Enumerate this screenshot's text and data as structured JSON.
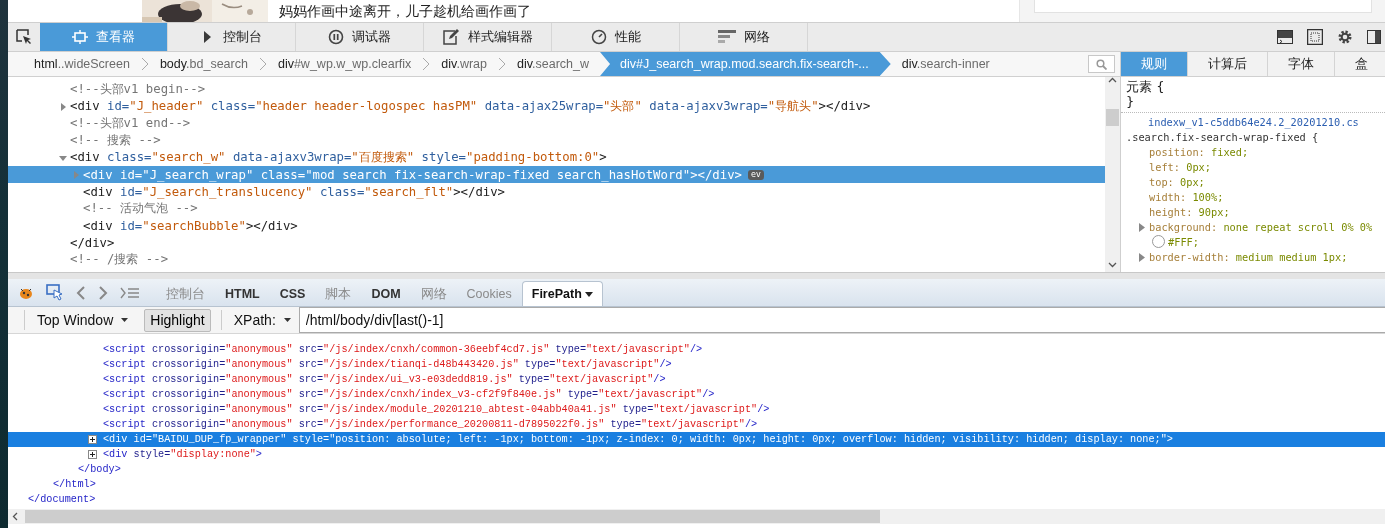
{
  "webpage": {
    "headline": "妈妈作画中途离开，儿子趁机给画作画了"
  },
  "devtools": {
    "tabs": [
      {
        "label": "查看器",
        "selected": true
      },
      {
        "label": "控制台",
        "selected": false
      },
      {
        "label": "调试器",
        "selected": false
      },
      {
        "label": "样式编辑器",
        "selected": false
      },
      {
        "label": "性能",
        "selected": false
      },
      {
        "label": "网络",
        "selected": false
      }
    ]
  },
  "breadcrumbs": [
    {
      "tag": "html",
      "detail": "..wideScreen",
      "selected": false
    },
    {
      "tag": "body",
      "detail": ".bd_search",
      "selected": false
    },
    {
      "tag": "div",
      "detail": "#w_wp.w_wp.clearfix",
      "selected": false
    },
    {
      "tag": "div",
      "detail": ".wrap",
      "selected": false
    },
    {
      "tag": "div",
      "detail": ".search_w",
      "selected": false
    },
    {
      "tag": "div",
      "detail": "#J_search_wrap.mod.search.fix-search-...",
      "selected": true
    },
    {
      "tag": "div",
      "detail": ".search-inner",
      "selected": false
    }
  ],
  "markup_view": {
    "nodes": [
      {
        "selected": false,
        "tokens": [
          {
            "kind": "comment",
            "text": "<!--头部v1 begin-->"
          }
        ]
      },
      {
        "selected": false,
        "expanded": false,
        "tokens": [
          {
            "kind": "tag",
            "text": "<div"
          },
          {
            "kind": "attr",
            "text": " id="
          },
          {
            "kind": "value",
            "text": "\"J_header\""
          },
          {
            "kind": "attr",
            "text": " class="
          },
          {
            "kind": "value",
            "text": "\"header header-logospec hasPM\""
          },
          {
            "kind": "attr",
            "text": " data-ajax25wrap="
          },
          {
            "kind": "value",
            "text": "\"头部\""
          },
          {
            "kind": "attr",
            "text": " data-ajaxv3wrap="
          },
          {
            "kind": "value",
            "text": "\"导航头\""
          },
          {
            "kind": "tag",
            "text": "></div>"
          }
        ]
      },
      {
        "selected": false,
        "tokens": [
          {
            "kind": "comment",
            "text": "<!--头部v1 end-->"
          }
        ]
      },
      {
        "selected": false,
        "tokens": [
          {
            "kind": "comment",
            "text": "<!-- 搜索 -->"
          }
        ]
      },
      {
        "selected": false,
        "expanded": true,
        "tokens": [
          {
            "kind": "tag",
            "text": "<div"
          },
          {
            "kind": "attr",
            "text": " class="
          },
          {
            "kind": "value",
            "text": "\"search_w\""
          },
          {
            "kind": "attr",
            "text": " data-ajaxv3wrap="
          },
          {
            "kind": "value",
            "text": "\"百度搜索\""
          },
          {
            "kind": "attr",
            "text": " style="
          },
          {
            "kind": "value",
            "text": "\"padding-bottom:0\""
          },
          {
            "kind": "tag",
            "text": ">"
          }
        ],
        "children": [
          {
            "selected": true,
            "expanded": false,
            "badge": "ev",
            "tokens": [
              {
                "kind": "tag",
                "text": "<div"
              },
              {
                "kind": "attr",
                "text": " id="
              },
              {
                "kind": "value",
                "text": "\"J_search_wrap\""
              },
              {
                "kind": "attr",
                "text": " class="
              },
              {
                "kind": "value",
                "text": "\"mod search fix-search-wrap-fixed search_hasHotWord\""
              },
              {
                "kind": "tag",
                "text": "></div>"
              }
            ]
          },
          {
            "selected": false,
            "tokens": [
              {
                "kind": "tag",
                "text": "<div"
              },
              {
                "kind": "attr",
                "text": " id="
              },
              {
                "kind": "value",
                "text": "\"J_search_translucency\""
              },
              {
                "kind": "attr",
                "text": " class="
              },
              {
                "kind": "value",
                "text": "\"search_flt\""
              },
              {
                "kind": "tag",
                "text": "></div>"
              }
            ]
          },
          {
            "selected": false,
            "tokens": [
              {
                "kind": "comment",
                "text": "<!-- 活动气泡 -->"
              }
            ]
          },
          {
            "selected": false,
            "tokens": [
              {
                "kind": "tag",
                "text": "<div"
              },
              {
                "kind": "attr",
                "text": " id="
              },
              {
                "kind": "value",
                "text": "\"searchBubble\""
              },
              {
                "kind": "tag",
                "text": "></div>"
              }
            ]
          }
        ],
        "closing": [
          {
            "kind": "tag",
            "text": "</div>"
          }
        ]
      },
      {
        "selected": false,
        "tokens": [
          {
            "kind": "comment",
            "text": "<!-- /搜索 -->"
          }
        ]
      }
    ]
  },
  "rules_panel": {
    "tabs": [
      {
        "label": "规则",
        "selected": true
      },
      {
        "label": "计算后",
        "selected": false
      },
      {
        "label": "字体",
        "selected": false
      },
      {
        "label": "盒",
        "selected": false
      }
    ],
    "element_rule": {
      "open": "元素 {",
      "close": "}"
    },
    "rule": {
      "source": "indexw_v1-c5ddb64e24.2_20201210.cs",
      "selector": ".search.fix-search-wrap-fixed {",
      "declarations": [
        {
          "name": "position:",
          "value": "fixed;",
          "expandable": false
        },
        {
          "name": "left:",
          "value": "0px;",
          "expandable": false
        },
        {
          "name": "top:",
          "value": "0px;",
          "expandable": false
        },
        {
          "name": "width:",
          "value": "100%;",
          "expandable": false
        },
        {
          "name": "height:",
          "value": "90px;",
          "expandable": false
        },
        {
          "name": "background:",
          "value": "none repeat scroll 0% 0%",
          "color_value": "#FFF;",
          "expandable": true
        },
        {
          "name": "border-width:",
          "value": "medium medium 1px;",
          "expandable": true
        }
      ]
    }
  },
  "firebug": {
    "tabs": [
      {
        "label": "控制台",
        "disabled": true,
        "selected": false,
        "menu": false
      },
      {
        "label": "HTML",
        "disabled": false,
        "selected": false,
        "menu": false
      },
      {
        "label": "CSS",
        "disabled": false,
        "selected": false,
        "menu": false
      },
      {
        "label": "脚本",
        "disabled": true,
        "selected": false,
        "menu": false
      },
      {
        "label": "DOM",
        "disabled": false,
        "selected": false,
        "menu": false
      },
      {
        "label": "网络",
        "disabled": true,
        "selected": false,
        "menu": false
      },
      {
        "label": "Cookies",
        "disabled": true,
        "selected": false,
        "menu": false
      },
      {
        "label": "FirePath",
        "disabled": false,
        "selected": true,
        "menu": true
      }
    ]
  },
  "firepath": {
    "frame_menu": "Top Window",
    "highlight": {
      "label": "Highlight",
      "pressed": true
    },
    "type_menu": "XPath:",
    "expression": "/html/body/div[last()-1]"
  },
  "firepath_tree": {
    "nodes": [
      {
        "selected": false,
        "closing": [
          {
            "kind": "tag",
            "text": "</document>"
          }
        ],
        "children": [
          {
            "selected": false,
            "closing": [
              {
                "kind": "tag",
                "text": "</html>"
              }
            ],
            "children": [
              {
                "selected": false,
                "closing": [
                  {
                    "kind": "tag",
                    "text": "</body>"
                  }
                ],
                "children": [
                  {
                    "selected": false,
                    "tokens": [
                      {
                        "kind": "tag",
                        "text": "<script"
                      },
                      {
                        "kind": "attr",
                        "text": " crossorigin="
                      },
                      {
                        "kind": "value",
                        "text": "\"anonymous\""
                      },
                      {
                        "kind": "attr",
                        "text": " src="
                      },
                      {
                        "kind": "value",
                        "text": "\"/js/index/cnxh/common-36eebf4cd7.js\""
                      },
                      {
                        "kind": "attr",
                        "text": " type="
                      },
                      {
                        "kind": "value",
                        "text": "\"text/javascript\""
                      },
                      {
                        "kind": "tag",
                        "text": "/>"
                      }
                    ]
                  },
                  {
                    "selected": false,
                    "tokens": [
                      {
                        "kind": "tag",
                        "text": "<script"
                      },
                      {
                        "kind": "attr",
                        "text": " crossorigin="
                      },
                      {
                        "kind": "value",
                        "text": "\"anonymous\""
                      },
                      {
                        "kind": "attr",
                        "text": " src="
                      },
                      {
                        "kind": "value",
                        "text": "\"/js/index/tianqi-d48b443420.js\""
                      },
                      {
                        "kind": "attr",
                        "text": " type="
                      },
                      {
                        "kind": "value",
                        "text": "\"text/javascript\""
                      },
                      {
                        "kind": "tag",
                        "text": "/>"
                      }
                    ]
                  },
                  {
                    "selected": false,
                    "tokens": [
                      {
                        "kind": "tag",
                        "text": "<script"
                      },
                      {
                        "kind": "attr",
                        "text": " crossorigin="
                      },
                      {
                        "kind": "value",
                        "text": "\"anonymous\""
                      },
                      {
                        "kind": "attr",
                        "text": " src="
                      },
                      {
                        "kind": "value",
                        "text": "\"/js/index/ui_v3-e03dedd819.js\""
                      },
                      {
                        "kind": "attr",
                        "text": " type="
                      },
                      {
                        "kind": "value",
                        "text": "\"text/javascript\""
                      },
                      {
                        "kind": "tag",
                        "text": "/>"
                      }
                    ]
                  },
                  {
                    "selected": false,
                    "tokens": [
                      {
                        "kind": "tag",
                        "text": "<script"
                      },
                      {
                        "kind": "attr",
                        "text": " crossorigin="
                      },
                      {
                        "kind": "value",
                        "text": "\"anonymous\""
                      },
                      {
                        "kind": "attr",
                        "text": " src="
                      },
                      {
                        "kind": "value",
                        "text": "\"/js/index/cnxh/index_v3-cf2f9f840e.js\""
                      },
                      {
                        "kind": "attr",
                        "text": " type="
                      },
                      {
                        "kind": "value",
                        "text": "\"text/javascript\""
                      },
                      {
                        "kind": "tag",
                        "text": "/>"
                      }
                    ]
                  },
                  {
                    "selected": false,
                    "tokens": [
                      {
                        "kind": "tag",
                        "text": "<script"
                      },
                      {
                        "kind": "attr",
                        "text": " crossorigin="
                      },
                      {
                        "kind": "value",
                        "text": "\"anonymous\""
                      },
                      {
                        "kind": "attr",
                        "text": " src="
                      },
                      {
                        "kind": "value",
                        "text": "\"/js/index/module_20201210_abtest-04abb40a41.js\""
                      },
                      {
                        "kind": "attr",
                        "text": " type="
                      },
                      {
                        "kind": "value",
                        "text": "\"text/javascript\""
                      },
                      {
                        "kind": "tag",
                        "text": "/>"
                      }
                    ]
                  },
                  {
                    "selected": false,
                    "tokens": [
                      {
                        "kind": "tag",
                        "text": "<script"
                      },
                      {
                        "kind": "attr",
                        "text": " crossorigin="
                      },
                      {
                        "kind": "value",
                        "text": "\"anonymous\""
                      },
                      {
                        "kind": "attr",
                        "text": " src="
                      },
                      {
                        "kind": "value",
                        "text": "\"/js/index/performance_20200811-d7895022f0.js\""
                      },
                      {
                        "kind": "attr",
                        "text": " type="
                      },
                      {
                        "kind": "value",
                        "text": "\"text/javascript\""
                      },
                      {
                        "kind": "tag",
                        "text": "/>"
                      }
                    ]
                  },
                  {
                    "selected": true,
                    "expanded": false,
                    "tokens": [
                      {
                        "kind": "tag",
                        "text": "<div"
                      },
                      {
                        "kind": "attr",
                        "text": " id="
                      },
                      {
                        "kind": "value",
                        "text": "\"BAIDU_DUP_fp_wrapper\""
                      },
                      {
                        "kind": "attr",
                        "text": " style="
                      },
                      {
                        "kind": "value",
                        "text": "\"position: absolute; left: -1px; bottom: -1px; z-index: 0; width: 0px; height: 0px; overflow: hidden; visibility: hidden; display: none;\""
                      },
                      {
                        "kind": "tag",
                        "text": ">"
                      }
                    ]
                  },
                  {
                    "selected": false,
                    "expanded": false,
                    "tokens": [
                      {
                        "kind": "tag",
                        "text": "<div"
                      },
                      {
                        "kind": "attr",
                        "text": " style="
                      },
                      {
                        "kind": "value",
                        "text": "\"display:none\""
                      },
                      {
                        "kind": "tag",
                        "text": ">"
                      }
                    ]
                  }
                ]
              }
            ]
          }
        ]
      }
    ]
  }
}
